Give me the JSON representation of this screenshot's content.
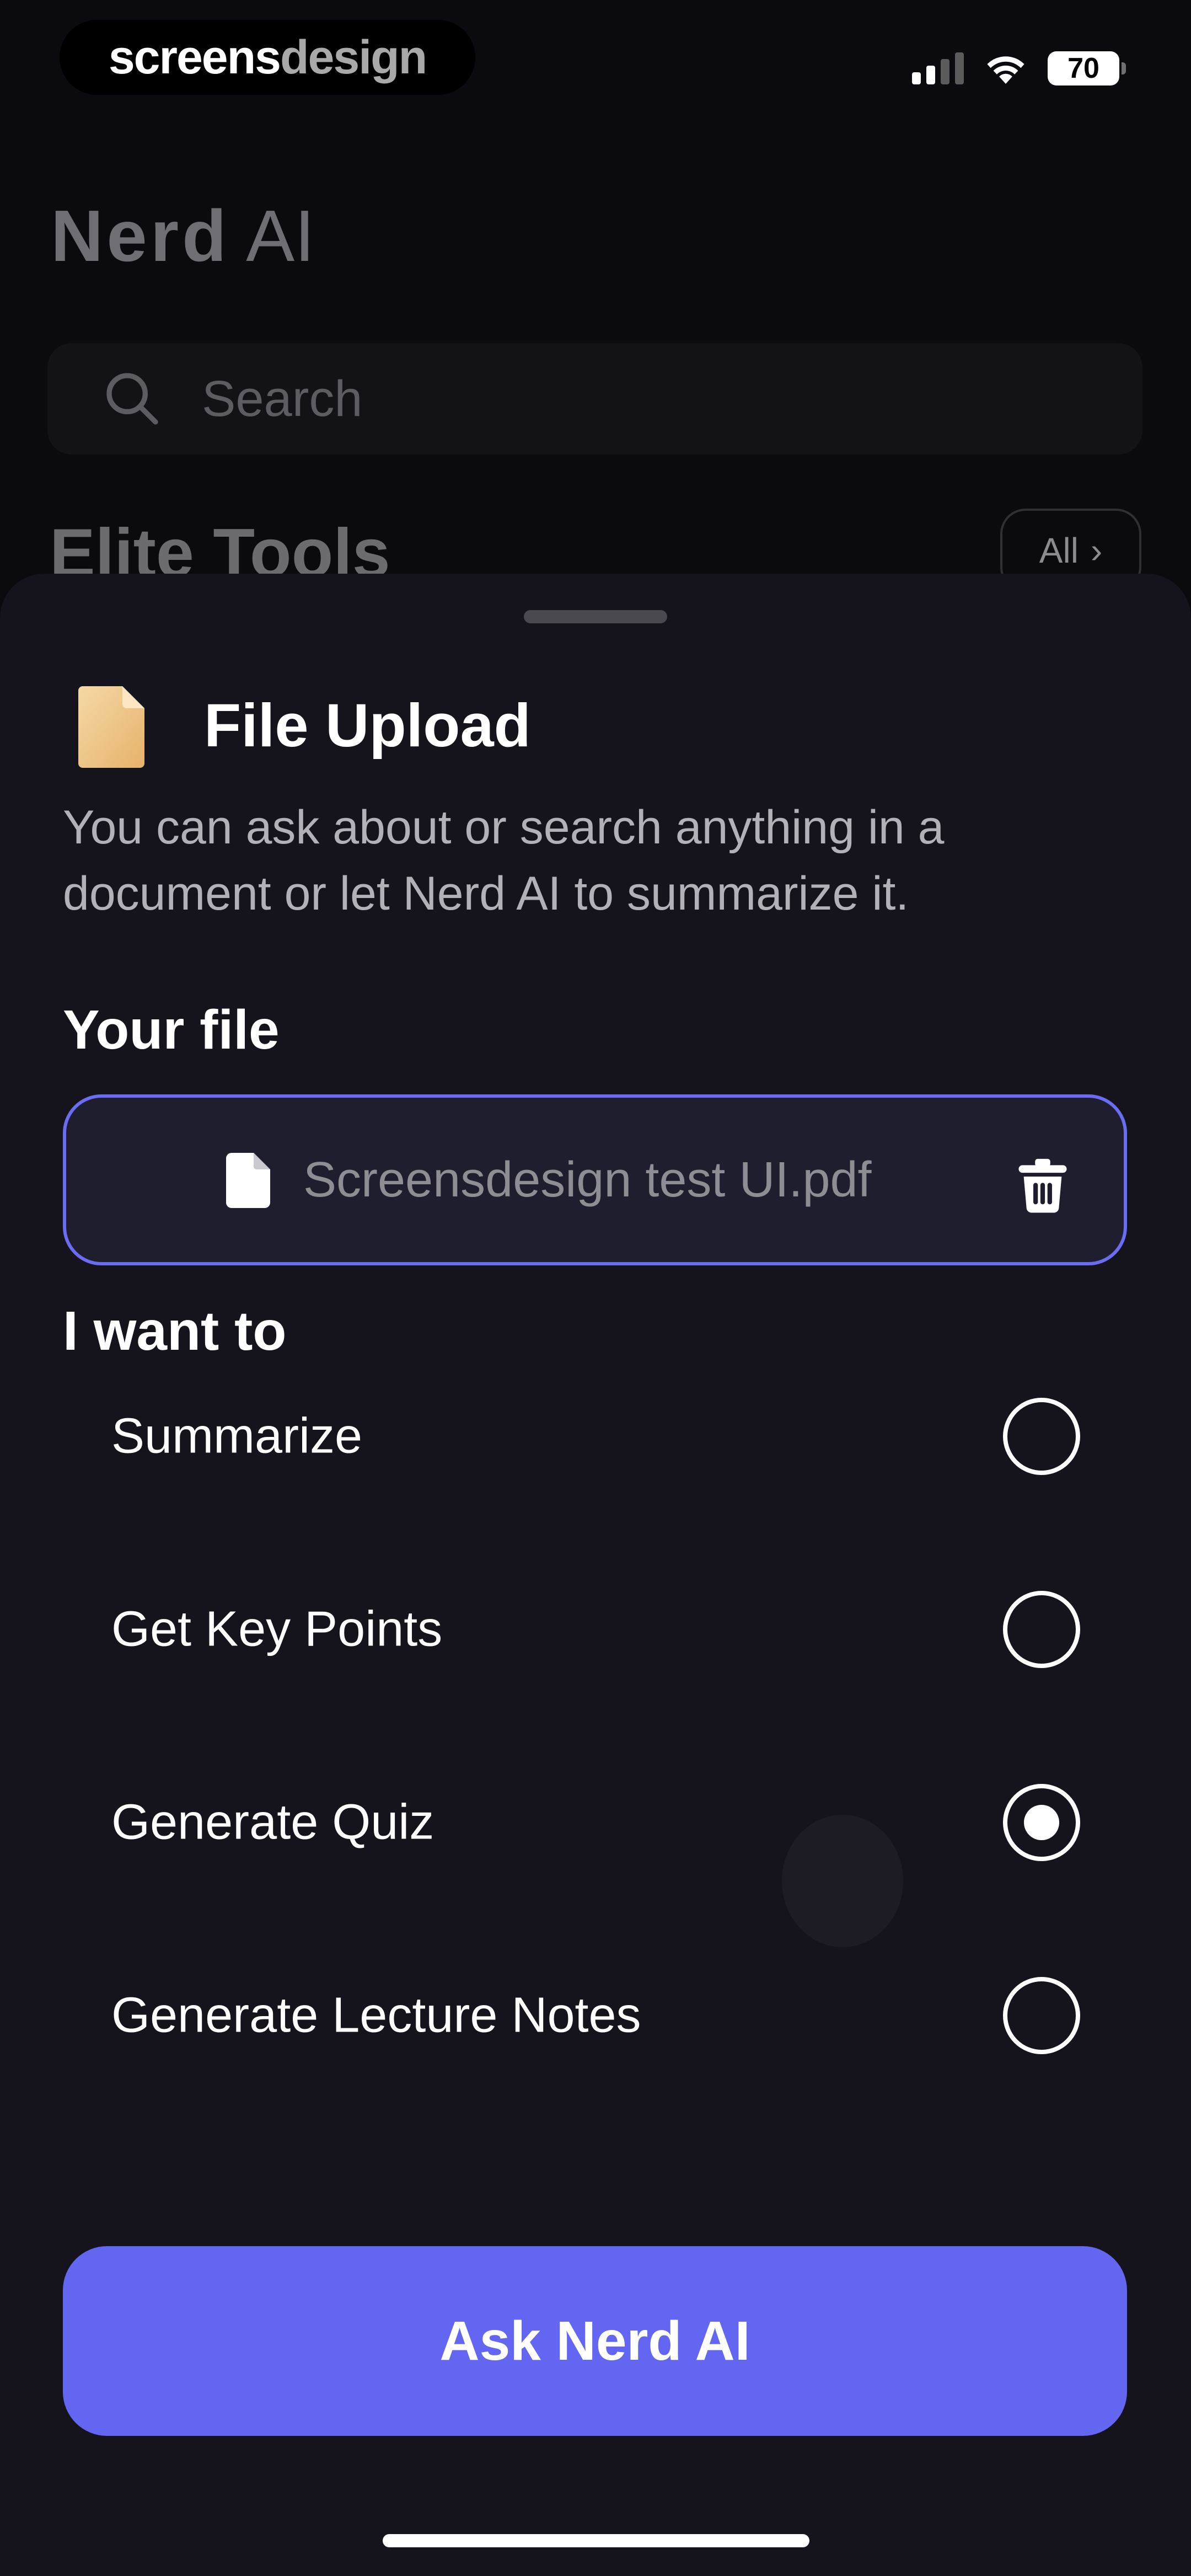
{
  "status_bar": {
    "watermark_part1": "screens",
    "watermark_part2": "design",
    "battery_level": "70",
    "signal_bars": 2,
    "signal_bars_total": 4,
    "icons": [
      "signal-icon",
      "wifi-icon",
      "battery-icon"
    ]
  },
  "background": {
    "app_title_bold": "Nerd",
    "app_title_light": "AI",
    "search_placeholder": "Search",
    "section_title": "Elite Tools",
    "all_label": "All",
    "all_chevron": "›"
  },
  "sheet": {
    "title": "File Upload",
    "description": "You can ask about or search anything in a document or let Nerd AI to summarize it.",
    "file_section_label": "Your file",
    "file_name": "Screensdesign test UI.pdf",
    "options_label": "I want to",
    "options": [
      {
        "label": "Summarize",
        "selected": false
      },
      {
        "label": "Get Key Points",
        "selected": false
      },
      {
        "label": "Generate Quiz",
        "selected": true
      },
      {
        "label": "Generate Lecture Notes",
        "selected": false
      }
    ],
    "submit_label": "Ask Nerd AI"
  },
  "colors": {
    "accent": "#6366f1",
    "file_border": "#6a6cf2",
    "sheet_bg": "#15131b",
    "page_bg": "#0b0a0e",
    "doc_icon": "#f0c98a"
  }
}
